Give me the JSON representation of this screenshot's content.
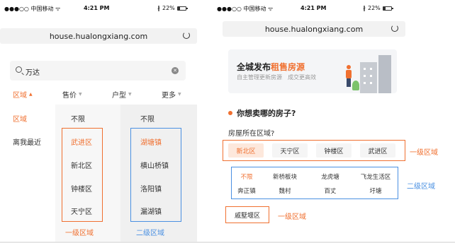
{
  "status": {
    "carrier": "●●●○○ 中国移动 ᯤ",
    "time": "4:21 PM",
    "battery": "22%"
  },
  "url": "house.hualongxiang.com",
  "left": {
    "search_value": "万达",
    "tabs": [
      {
        "label": "区域",
        "active": true
      },
      {
        "label": "售价",
        "active": false
      },
      {
        "label": "户型",
        "active": false
      },
      {
        "label": "更多",
        "active": false
      }
    ],
    "col1": [
      "区域",
      "离我最近"
    ],
    "col2": [
      "不限",
      "武进区",
      "新北区",
      "钟楼区",
      "天宁区"
    ],
    "col3": [
      "不限",
      "湖塘镇",
      "横山桥镇",
      "洛阳镇",
      "漏湖镇"
    ],
    "caption_level1": "一级区域",
    "caption_level2": "二级区域"
  },
  "right": {
    "banner_title_prefix": "全城发布",
    "banner_title_highlight": "租售房源",
    "banner_subtitle": "自主管理更新房源　成交更高效",
    "question": "你想卖哪的房子?",
    "prompt": "房屋所在区域?",
    "level1_chips": [
      "新北区",
      "天宁区",
      "钟楼区",
      "武进区"
    ],
    "level2_row1": [
      "不限",
      "新桥板块",
      "龙虎塘",
      "飞龙生活区"
    ],
    "level2_row2": [
      "奔正镇",
      "魏村",
      "百丈",
      "圩塘"
    ],
    "bottom_chip": "戚墅堰区",
    "caption_level1": "一级区域",
    "caption_level2": "二级区域",
    "caption_level1_bottom": "一级区域"
  },
  "colors": {
    "accent": "#f07030",
    "blue": "#4a90e2"
  }
}
